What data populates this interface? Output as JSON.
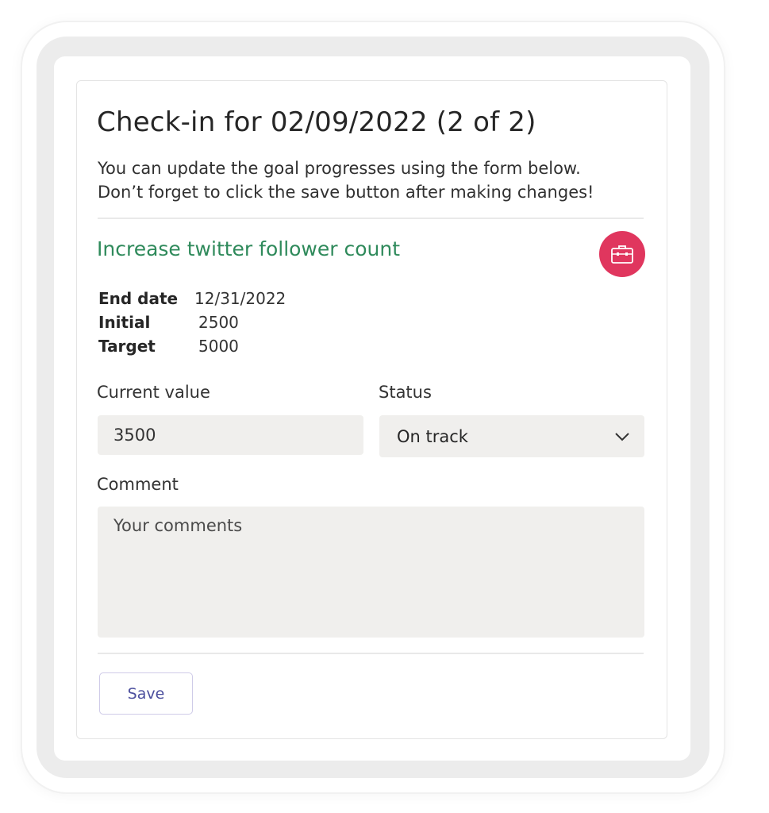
{
  "checkin": {
    "title": "Check-in for 02/09/2022 (2 of 2)",
    "intro_line1": "You can update the goal progresses using the form below.",
    "intro_line2": "Don’t forget to click the save button after making changes!"
  },
  "goal": {
    "name": "Increase twitter follower count",
    "name_color": "#2f8a5b",
    "icon": "briefcase-icon",
    "icon_bg_color": "#e0365e",
    "details": [
      {
        "label": "End date",
        "value": "12/31/2022"
      },
      {
        "label": "Initial",
        "value": "2500"
      },
      {
        "label": "Target",
        "value": "5000"
      }
    ]
  },
  "form": {
    "current_value_label": "Current value",
    "current_value": "3500",
    "status_label": "Status",
    "status_selected": "On track",
    "status_icon": "chevron-down-icon",
    "comment_label": "Comment",
    "comment_placeholder": "Your comments",
    "save_label": "Save"
  }
}
